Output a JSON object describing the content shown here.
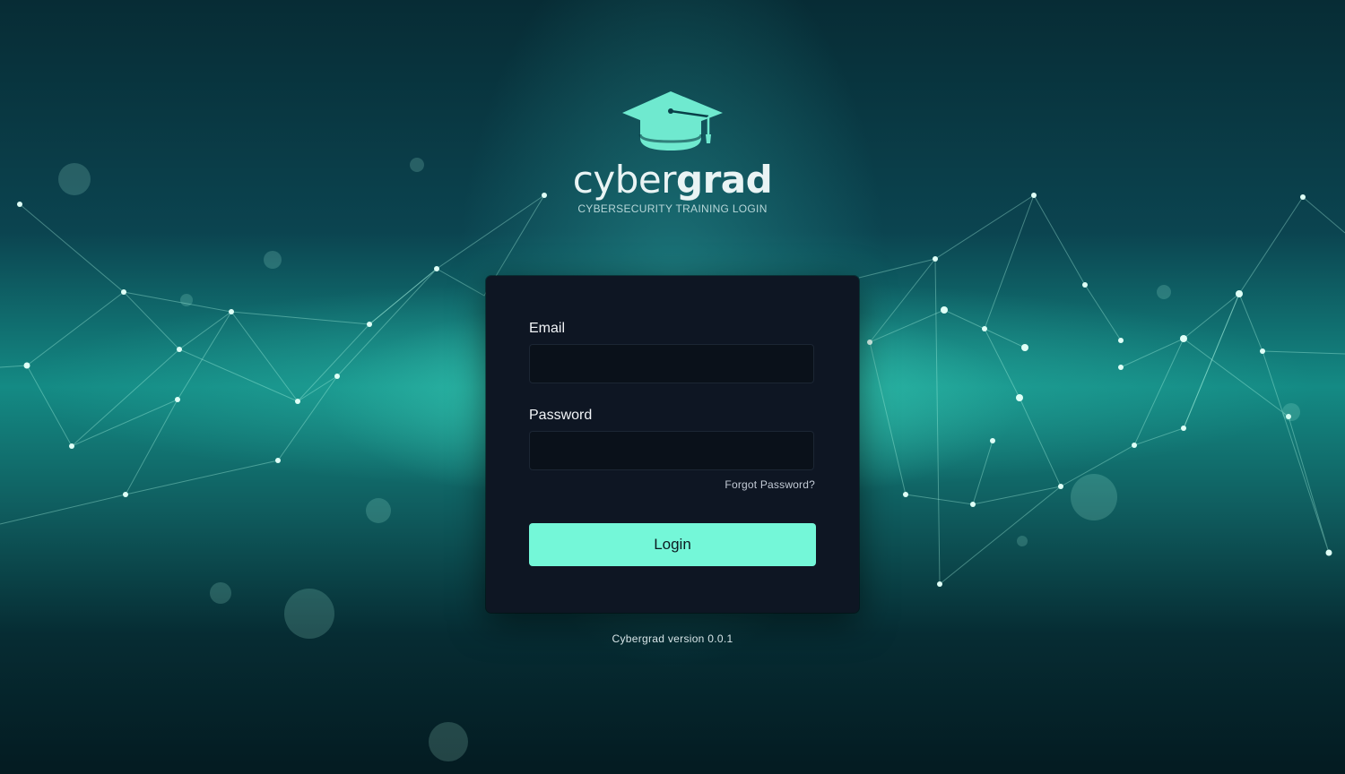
{
  "brand": {
    "name_light": "cyber",
    "name_bold": "grad",
    "tagline": "CYBERSECURITY TRAINING LOGIN",
    "logo_icon": "graduation-cap-icon",
    "accent_color": "#74f7d8"
  },
  "form": {
    "email_label": "Email",
    "email_value": "",
    "password_label": "Password",
    "password_value": "",
    "forgot_password": "Forgot Password?",
    "login_label": "Login"
  },
  "footer": {
    "version": "Cybergrad version 0.0.1"
  }
}
